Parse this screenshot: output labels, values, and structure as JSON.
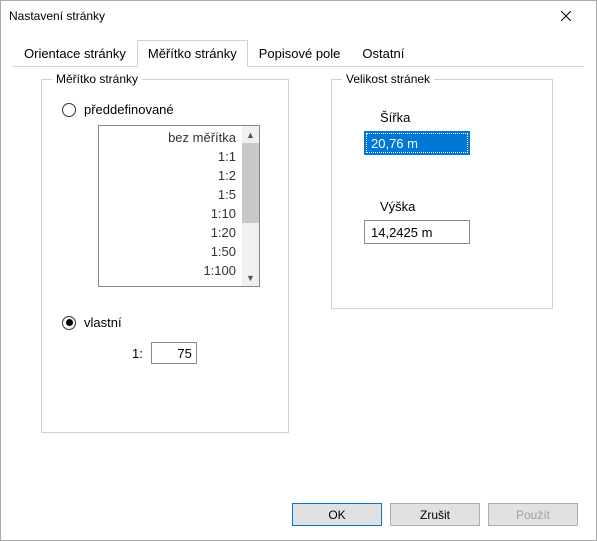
{
  "window": {
    "title": "Nastavení stránky"
  },
  "tabs": {
    "items": [
      {
        "label": "Orientace stránky"
      },
      {
        "label": "Měřítko stránky"
      },
      {
        "label": "Popisové pole"
      },
      {
        "label": "Ostatní"
      }
    ],
    "active": 1
  },
  "scale": {
    "legend": "Měřítko stránky",
    "radio_predefined": "předdefinované",
    "radio_custom": "vlastní",
    "selected": "custom",
    "list": [
      "bez měřítka",
      "1:1",
      "1:2",
      "1:5",
      "1:10",
      "1:20",
      "1:50",
      "1:100"
    ],
    "custom_prefix": "1:",
    "custom_value": "75"
  },
  "size": {
    "legend": "Velikost stránek",
    "width_label": "Šířka",
    "width_value": "20,76 m",
    "height_label": "Výška",
    "height_value": "14,2425 m"
  },
  "buttons": {
    "ok": "OK",
    "cancel": "Zrušit",
    "apply": "Použít"
  }
}
